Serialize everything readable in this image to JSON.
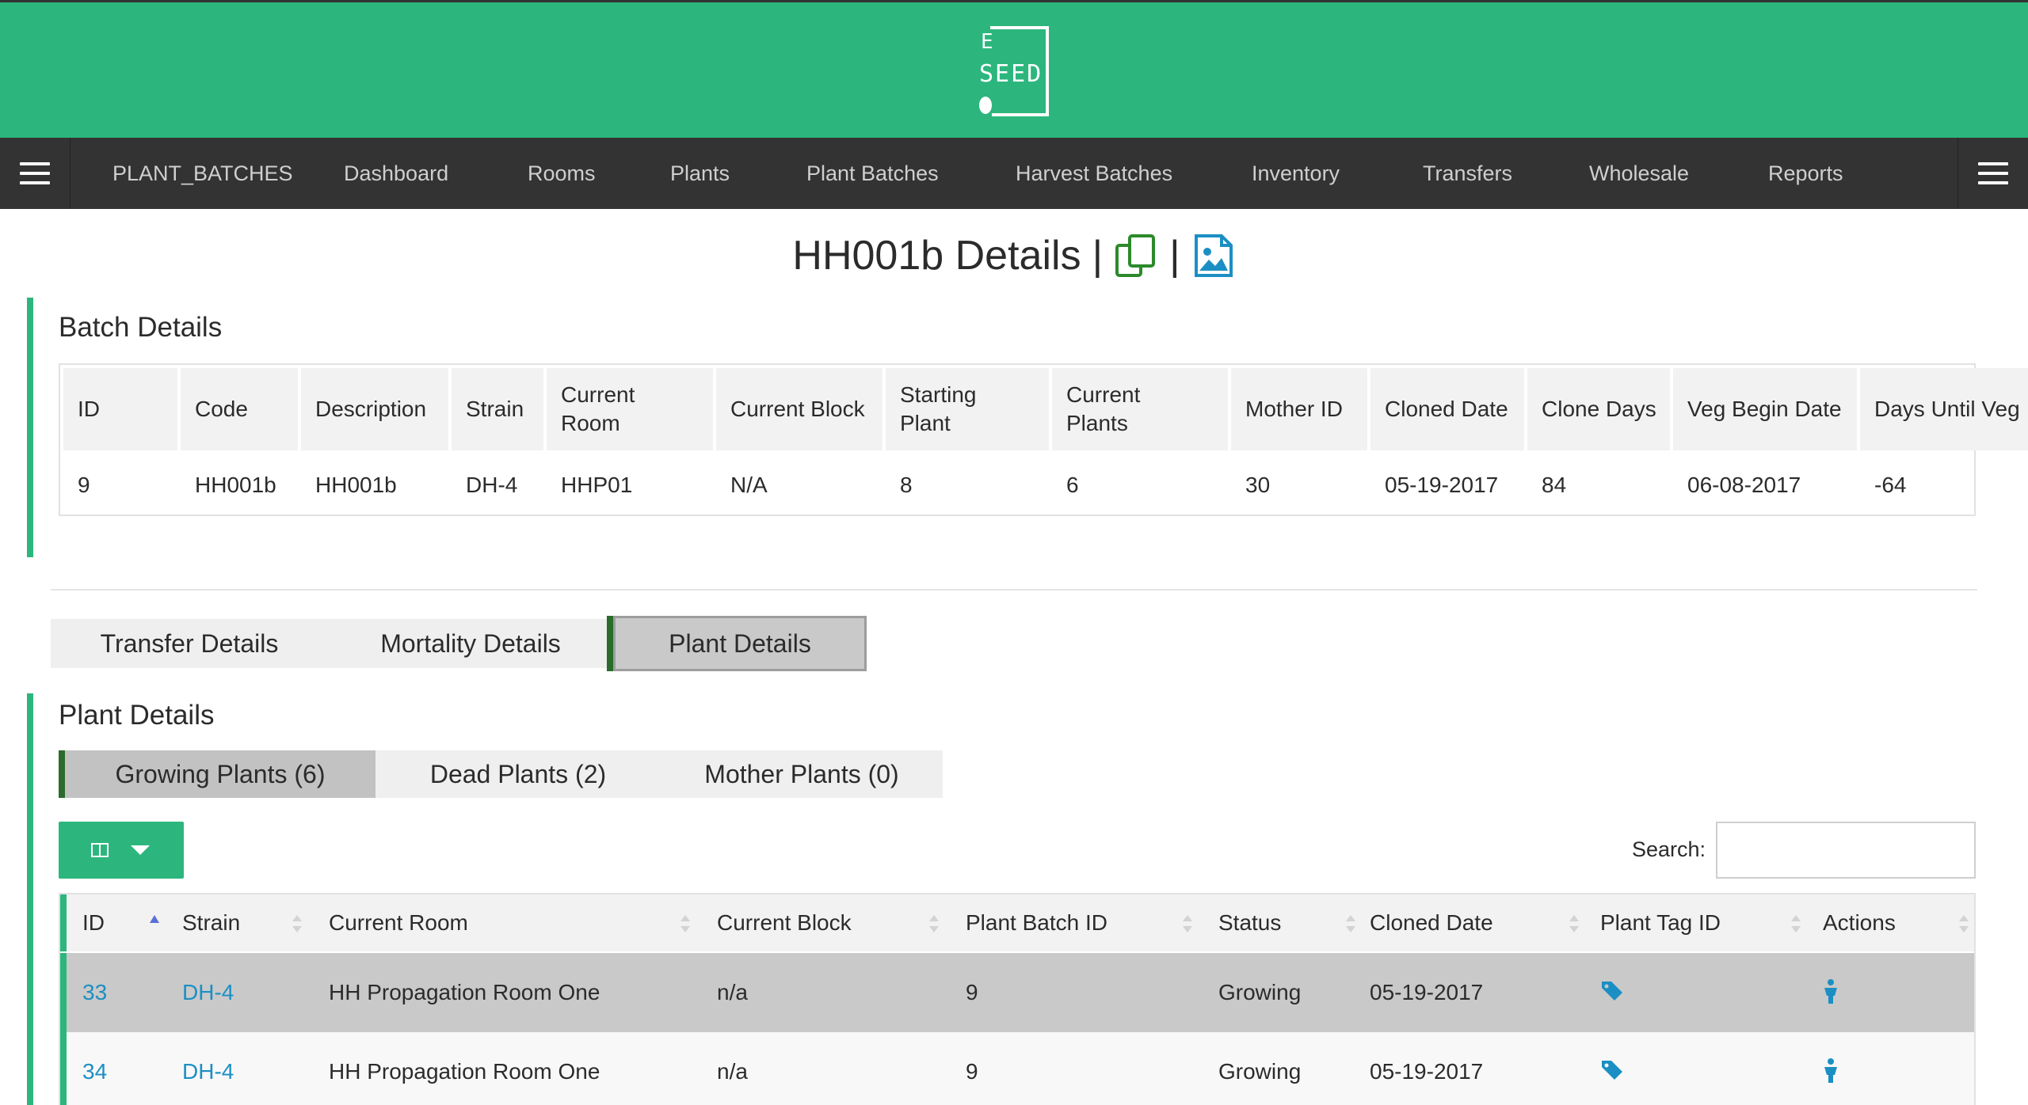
{
  "brand": {
    "logo_text_top": "E",
    "logo_text_bottom": "SEED"
  },
  "nav": {
    "items": [
      "PLANT_BATCHES",
      "Dashboard",
      "Rooms",
      "Plants",
      "Plant Batches",
      "Harvest Batches",
      "Inventory",
      "Transfers",
      "Wholesale",
      "Reports"
    ]
  },
  "page": {
    "title": "HH001b Details",
    "separator": "|"
  },
  "batch": {
    "heading": "Batch Details",
    "headers": [
      "ID",
      "Code",
      "Description",
      "Strain",
      "Current Room",
      "Current Block",
      "Starting Plant",
      "Current Plants",
      "Mother ID",
      "Cloned Date",
      "Clone Days",
      "Veg Begin Date",
      "Days Until Veg"
    ],
    "row": [
      "9",
      "HH001b",
      "HH001b",
      "DH-4",
      "HHP01",
      "N/A",
      "8",
      "6",
      "30",
      "05-19-2017",
      "84",
      "06-08-2017",
      "-64"
    ]
  },
  "tabs": [
    "Transfer Details",
    "Mortality Details",
    "Plant Details"
  ],
  "plant_details": {
    "heading": "Plant Details",
    "subtabs": [
      "Growing Plants (6)",
      "Dead Plants (2)",
      "Mother Plants (0)"
    ],
    "search_label": "Search:",
    "search_value": "",
    "headers": [
      "ID",
      "Strain",
      "Current Room",
      "Current Block",
      "Plant Batch ID",
      "Status",
      "Cloned Date",
      "Plant Tag ID",
      "Actions"
    ],
    "rows": [
      {
        "id": "33",
        "strain": "DH-4",
        "room": "HH Propagation Room One",
        "block": "n/a",
        "batch_id": "9",
        "status": "Growing",
        "cloned": "05-19-2017"
      },
      {
        "id": "34",
        "strain": "DH-4",
        "room": "HH Propagation Room One",
        "block": "n/a",
        "batch_id": "9",
        "status": "Growing",
        "cloned": "05-19-2017"
      }
    ]
  },
  "colors": {
    "brand_green": "#2cb67d",
    "nav_dark": "#333333",
    "link_blue": "#1b8fc4",
    "dark_green": "#2b6b2b"
  }
}
